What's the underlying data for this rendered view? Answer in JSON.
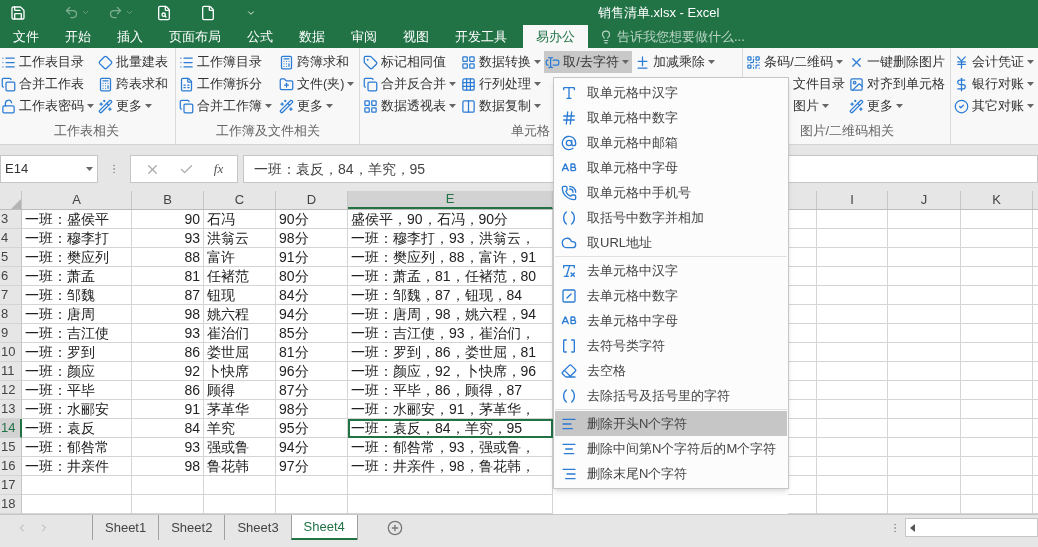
{
  "title_bar": {
    "title": "销售清单.xlsx - Excel"
  },
  "tabs": [
    {
      "label": "文件",
      "selected": false
    },
    {
      "label": "开始",
      "selected": false
    },
    {
      "label": "插入",
      "selected": false
    },
    {
      "label": "页面布局",
      "selected": false
    },
    {
      "label": "公式",
      "selected": false
    },
    {
      "label": "数据",
      "selected": false
    },
    {
      "label": "审阅",
      "selected": false
    },
    {
      "label": "视图",
      "selected": false
    },
    {
      "label": "开发工具",
      "selected": false
    },
    {
      "label": "易办公",
      "selected": true
    }
  ],
  "tell_me": {
    "placeholder": "告诉我您想要做什么..."
  },
  "ribbon_groups": [
    {
      "label": "工作表相关",
      "columns": [
        [
          {
            "label": "工作表目录",
            "dropdown": false,
            "expanded": false
          },
          {
            "label": "合并工作表",
            "dropdown": false,
            "expanded": false
          },
          {
            "label": "工作表密码",
            "dropdown": true,
            "expanded": false
          }
        ],
        [
          {
            "label": "批量建表",
            "dropdown": false,
            "expanded": false
          },
          {
            "label": "跨表求和",
            "dropdown": false,
            "expanded": false
          },
          {
            "label": "更多",
            "dropdown": true,
            "expanded": false
          }
        ]
      ]
    },
    {
      "label": "工作簿及文件相关",
      "columns": [
        [
          {
            "label": "工作簿目录",
            "dropdown": false,
            "expanded": false
          },
          {
            "label": "工作簿拆分",
            "dropdown": false,
            "expanded": false
          },
          {
            "label": "合并工作簿",
            "dropdown": true,
            "expanded": false
          }
        ],
        [
          {
            "label": "跨簿求和",
            "dropdown": false,
            "expanded": false
          },
          {
            "label": "文件(夹)",
            "dropdown": true,
            "expanded": false
          },
          {
            "label": "更多",
            "dropdown": true,
            "expanded": false
          }
        ]
      ]
    },
    {
      "label": "单元格",
      "columns": [
        [
          {
            "label": "标记相同值",
            "dropdown": false,
            "expanded": false
          },
          {
            "label": "合并反合并",
            "dropdown": true,
            "expanded": false
          },
          {
            "label": "数据透视表",
            "dropdown": true,
            "expanded": false
          }
        ],
        [
          {
            "label": "数据转换",
            "dropdown": true,
            "expanded": false
          },
          {
            "label": "行列处理",
            "dropdown": true,
            "expanded": false
          },
          {
            "label": "数据复制",
            "dropdown": true,
            "expanded": false
          }
        ],
        [
          {
            "label": "取/去字符",
            "dropdown": true,
            "expanded": true
          }
        ],
        [
          {
            "label": "加减乘除",
            "dropdown": true,
            "expanded": false
          }
        ]
      ]
    },
    {
      "label": "图片/二维码相关",
      "columns": [
        [
          {
            "label": "条码/二维码",
            "dropdown": true,
            "expanded": false
          },
          {
            "label": "文件目录",
            "dropdown": false,
            "expanded": false
          },
          {
            "label": "图片",
            "dropdown": true,
            "expanded": false
          }
        ],
        [
          {
            "label": "一键删除图片",
            "dropdown": false,
            "expanded": false
          },
          {
            "label": "对齐到单元格",
            "dropdown": false,
            "expanded": false
          },
          {
            "label": "更多",
            "dropdown": true,
            "expanded": false
          }
        ]
      ]
    },
    {
      "columns": [
        [
          {
            "label": "会计凭证",
            "dropdown": true,
            "expanded": false
          },
          {
            "label": "银行对账",
            "dropdown": true,
            "expanded": false
          },
          {
            "label": "其它对账",
            "dropdown": true,
            "expanded": false
          }
        ]
      ]
    }
  ],
  "formula_bar": {
    "name_box": "E14",
    "function_label": "fx",
    "value": "一班：袁反，84，羊究，95"
  },
  "sheet": {
    "columns": [
      {
        "label": "A",
        "selected": false
      },
      {
        "label": "B",
        "selected": false
      },
      {
        "label": "C",
        "selected": false
      },
      {
        "label": "D",
        "selected": false
      },
      {
        "label": "E",
        "selected": true
      },
      {
        "label": "I",
        "selected": false
      },
      {
        "label": "J",
        "selected": false
      },
      {
        "label": "K",
        "selected": false
      }
    ],
    "rows": [
      {
        "number": "3",
        "selected": false,
        "cells": [
          "一班：盛侯平",
          "90",
          "石冯",
          "90分",
          "盛侯平，90，石冯，90分"
        ]
      },
      {
        "number": "4",
        "selected": false,
        "cells": [
          "一班：穆李打",
          "93",
          "洪翁云",
          "98分",
          "一班：穆李打，93，洪翁云，"
        ]
      },
      {
        "number": "5",
        "selected": false,
        "cells": [
          "一班：樊应列",
          "88",
          "富许",
          "91分",
          "一班：樊应列，88，富许，91"
        ]
      },
      {
        "number": "6",
        "selected": false,
        "cells": [
          "一班：萧孟",
          "81",
          "任褚范",
          "80分",
          "一班：萧孟，81，任褚范，80"
        ]
      },
      {
        "number": "7",
        "selected": false,
        "cells": [
          "一班：邹魏",
          "87",
          "钮现",
          "84分",
          "一班：邹魏，87，钮现，84"
        ]
      },
      {
        "number": "8",
        "selected": false,
        "cells": [
          "一班：唐周",
          "98",
          "姚六程",
          "94分",
          "一班：唐周，98，姚六程，94"
        ]
      },
      {
        "number": "9",
        "selected": false,
        "cells": [
          "一班：吉江使",
          "93",
          "崔治们",
          "85分",
          "一班：吉江使，93，崔治们，"
        ]
      },
      {
        "number": "10",
        "selected": false,
        "cells": [
          "一班：罗到",
          "86",
          "娄世屈",
          "81分",
          "一班：罗到，86，娄世屈，81"
        ]
      },
      {
        "number": "11",
        "selected": false,
        "cells": [
          "一班：颜应",
          "92",
          "卜快席",
          "96分",
          "一班：颜应，92，卜快席，96"
        ]
      },
      {
        "number": "12",
        "selected": false,
        "cells": [
          "一班：平毕",
          "86",
          "顾得",
          "87分",
          "一班：平毕，86，顾得，87"
        ]
      },
      {
        "number": "13",
        "selected": false,
        "cells": [
          "一班：水郦安",
          "91",
          "茅革华",
          "98分",
          "一班：水郦安，91，茅革华，"
        ]
      },
      {
        "number": "14",
        "selected": true,
        "cells": [
          "一班：袁反",
          "84",
          "羊究",
          "95分",
          "一班：袁反，84，羊究，95"
        ]
      },
      {
        "number": "15",
        "selected": false,
        "cells": [
          "一班：郁咎常",
          "93",
          "强或鲁",
          "94分",
          "一班：郁咎常，93，强或鲁，"
        ]
      },
      {
        "number": "16",
        "selected": false,
        "cells": [
          "一班：井亲件",
          "98",
          "鲁花韩",
          "97分",
          "一班：井亲件，98，鲁花韩，"
        ]
      },
      {
        "number": "17",
        "selected": false
      },
      {
        "number": "18",
        "selected": false
      }
    ]
  },
  "sheet_tabs": [
    {
      "label": "Sheet1",
      "selected": false
    },
    {
      "label": "Sheet2",
      "selected": false
    },
    {
      "label": "Sheet3",
      "selected": false
    },
    {
      "label": "Sheet4",
      "selected": true
    }
  ],
  "dropdown_menu": {
    "sections": [
      [
        {
          "label": "取单元格中汉字",
          "highlighted": false
        },
        {
          "label": "取单元格中数字",
          "highlighted": false
        },
        {
          "label": "取单元格中邮箱",
          "highlighted": false
        },
        {
          "label": "取单元格中字母",
          "highlighted": false
        },
        {
          "label": "取单元格中手机号",
          "highlighted": false
        },
        {
          "label": "取括号中数字并相加",
          "highlighted": false
        },
        {
          "label": "取URL地址",
          "highlighted": false
        }
      ],
      [
        {
          "label": "去单元格中汉字",
          "highlighted": false
        },
        {
          "label": "去单元格中数字",
          "highlighted": false
        },
        {
          "label": "去单元格中字母",
          "highlighted": false
        },
        {
          "label": "去符号类字符",
          "highlighted": false
        },
        {
          "label": "去空格",
          "highlighted": false
        },
        {
          "label": "去除括号及括号里的字符",
          "highlighted": false
        }
      ],
      [
        {
          "label": "删除开头N个字符",
          "highlighted": true
        },
        {
          "label": "删除中间第N个字符后的M个字符",
          "highlighted": false
        },
        {
          "label": "删除末尾N个字符",
          "highlighted": false
        }
      ]
    ]
  }
}
